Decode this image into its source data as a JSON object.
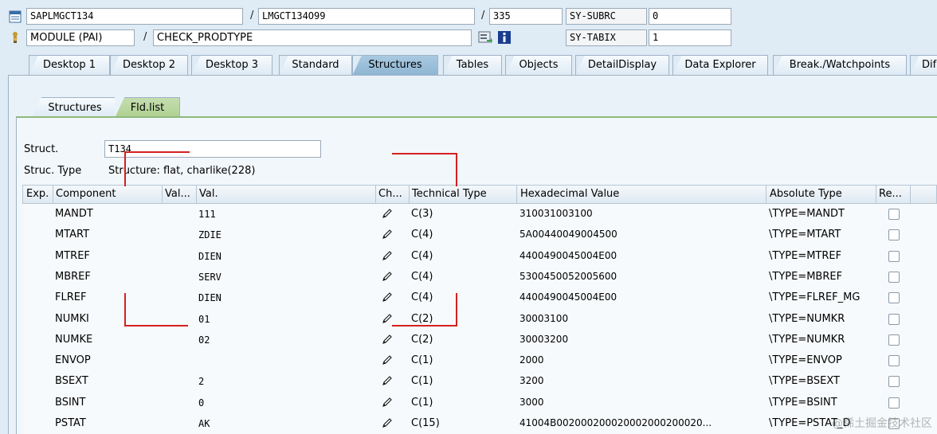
{
  "header": {
    "program": "SAPLMGCT134",
    "include": "LMGCT134O99",
    "line": "335",
    "subrc_label": "SY-SUBRC",
    "subrc_value": "0",
    "module": "MODULE (PAI)",
    "module_name": "CHECK_PRODTYPE",
    "tabix_label": "SY-TABIX",
    "tabix_value": "1",
    "slash": "/"
  },
  "tabs": [
    {
      "label": "Desktop 1"
    },
    {
      "label": "Desktop 2"
    },
    {
      "label": "Desktop 3"
    },
    {
      "label": "Standard"
    },
    {
      "label": "Structures",
      "active": true
    },
    {
      "label": "Tables"
    },
    {
      "label": "Objects"
    },
    {
      "label": "DetailDisplay"
    },
    {
      "label": "Data Explorer"
    },
    {
      "label": "Break./Watchpoints"
    },
    {
      "label": "Dif"
    }
  ],
  "subtabs": [
    {
      "label": "Structures"
    },
    {
      "label": "Fld.list",
      "active": true
    }
  ],
  "struct": {
    "label": "Struct.",
    "value": "T134",
    "type_label": "Struc. Type",
    "type_value": "Structure: flat, charlike(228)"
  },
  "table": {
    "columns": [
      "Exp.",
      "Component",
      "Val...",
      "Val.",
      "Ch...",
      "Technical Type",
      "Hexadecimal Value",
      "Absolute Type",
      "Re..."
    ],
    "rows": [
      {
        "component": "MANDT",
        "val": "111",
        "type": "C(3)",
        "hex": "310031003100",
        "abs": "\\TYPE=MANDT"
      },
      {
        "component": "MTART",
        "val": "ZDIE",
        "type": "C(4)",
        "hex": "5A00440049004500",
        "abs": "\\TYPE=MTART"
      },
      {
        "component": "MTREF",
        "val": "DIEN",
        "type": "C(4)",
        "hex": "4400490045004E00",
        "abs": "\\TYPE=MTREF"
      },
      {
        "component": "MBREF",
        "val": "SERV",
        "type": "C(4)",
        "hex": "5300450052005600",
        "abs": "\\TYPE=MBREF"
      },
      {
        "component": "FLREF",
        "val": "DIEN",
        "type": "C(4)",
        "hex": "4400490045004E00",
        "abs": "\\TYPE=FLREF_MG"
      },
      {
        "component": "NUMKI",
        "val": "01",
        "type": "C(2)",
        "hex": "30003100",
        "abs": "\\TYPE=NUMKR"
      },
      {
        "component": "NUMKE",
        "val": "02",
        "type": "C(2)",
        "hex": "30003200",
        "abs": "\\TYPE=NUMKR"
      },
      {
        "component": "ENVOP",
        "val": "",
        "type": "C(1)",
        "hex": "2000",
        "abs": "\\TYPE=ENVOP"
      },
      {
        "component": "BSEXT",
        "val": "2",
        "type": "C(1)",
        "hex": "3200",
        "abs": "\\TYPE=BSEXT"
      },
      {
        "component": "BSINT",
        "val": "0",
        "type": "C(1)",
        "hex": "3000",
        "abs": "\\TYPE=BSINT"
      },
      {
        "component": "PSTAT",
        "val": "AK",
        "type": "C(15)",
        "hex": "41004B002000200020002000200020...",
        "abs": "\\TYPE=PSTAT_D"
      }
    ]
  },
  "watermark": "@稀土掘金技术社区",
  "colors": {
    "background": "#dfebf5",
    "active_tab": "#8db5d3",
    "active_subtab": "#aed08f",
    "annotation": "#d42020"
  }
}
